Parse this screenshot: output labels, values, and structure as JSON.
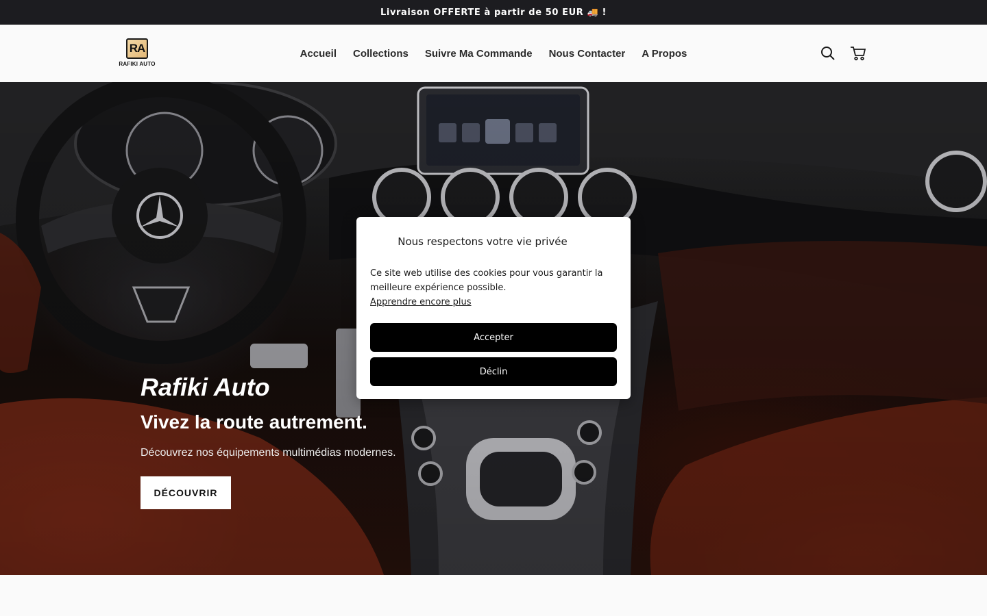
{
  "announcement": "Livraison OFFERTE à partir de 50 EUR 🚚 !",
  "logo": {
    "mark": "RA",
    "text": "RAFIKI AUTO"
  },
  "nav": {
    "items": [
      {
        "label": "Accueil"
      },
      {
        "label": "Collections"
      },
      {
        "label": "Suivre Ma Commande"
      },
      {
        "label": "Nous Contacter"
      },
      {
        "label": "A Propos"
      }
    ]
  },
  "header_icons": [
    "search-icon",
    "cart-icon"
  ],
  "hero": {
    "title": "Rafiki Auto",
    "subtitle": "Vivez la route autrement.",
    "text": "Découvrez nos équipements multimédias modernes.",
    "button": "DÉCOUVRIR"
  },
  "cookie_modal": {
    "title": "Nous respectons votre vie privée",
    "body": "Ce site web utilise des cookies pour vous garantir la meilleure expérience possible.",
    "link": "Apprendre encore plus",
    "accept": "Accepter",
    "decline": "Déclin"
  },
  "colors": {
    "announcement_bg": "#1c1c20",
    "header_bg": "#fafafa",
    "modal_button_bg": "#000000",
    "hero_button_bg": "#ffffff"
  }
}
